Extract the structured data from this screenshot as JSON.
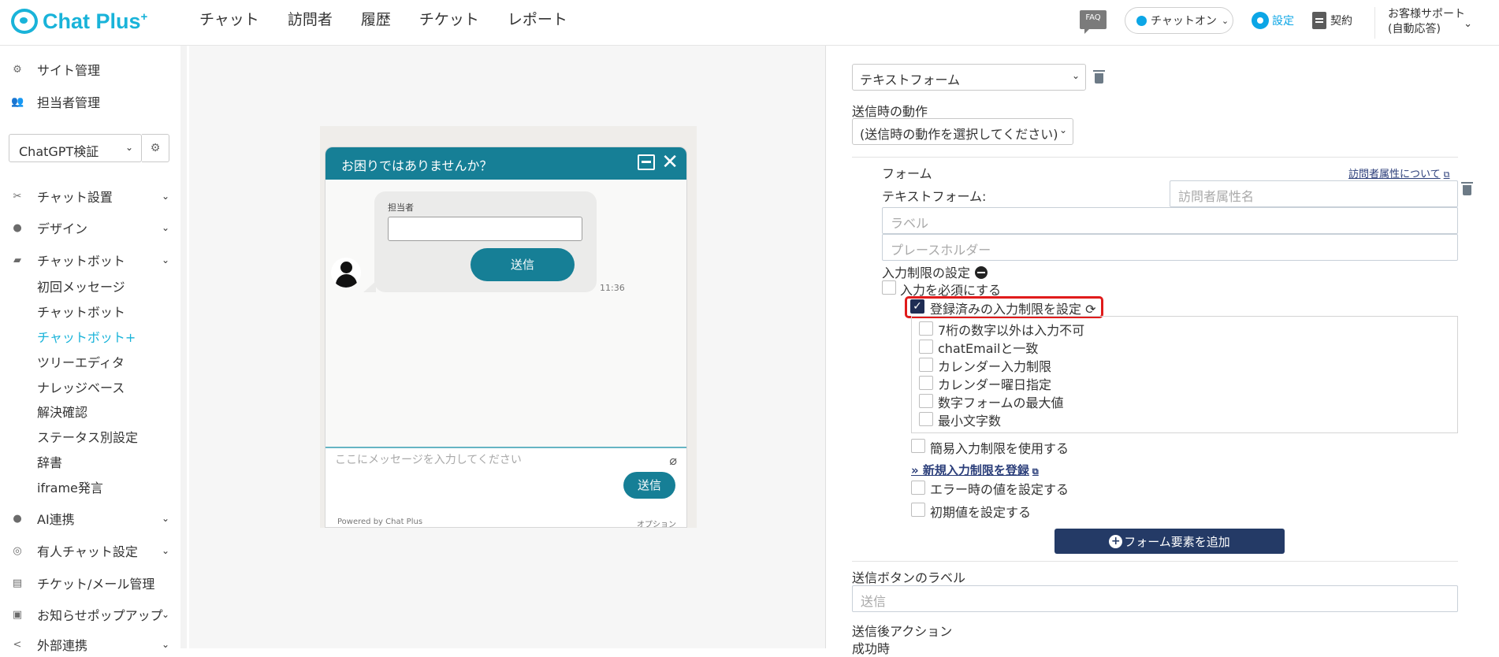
{
  "header": {
    "logo": "Chat Plus",
    "logo_sup": "+",
    "nav": [
      "チャット",
      "訪問者",
      "履歴",
      "チケット",
      "レポート"
    ],
    "faq": "FAQ",
    "status": "チャットオン",
    "settings": "設定",
    "contract": "契約",
    "support_line1": "お客様サポート",
    "support_line2": "(自動応答)"
  },
  "sidebar": {
    "site_admin": "サイト管理",
    "staff_admin": "担当者管理",
    "site_select": "ChatGPT検証",
    "chat_setup": "チャット設置",
    "design": "デザイン",
    "chatbot": "チャットボット",
    "chatbot_sub": [
      "初回メッセージ",
      "チャットボット",
      "チャットボット+",
      "ツリーエディタ",
      "ナレッジベース",
      "解決確認",
      "ステータス別設定",
      "辞書",
      "iframe発言"
    ],
    "ai": "AI連携",
    "manned": "有人チャット設定",
    "ticket_mail": "チケット/メール管理",
    "popup": "お知らせポップアップ",
    "external": "外部連携"
  },
  "preview": {
    "title": "お困りではありませんか？",
    "bubble_label": "担当者",
    "bubble_send": "送信",
    "time": "11:36",
    "input_placeholder": "ここにメッセージを入力してください",
    "send": "送信",
    "powered": "Powered by Chat Plus",
    "option": "オプション"
  },
  "form": {
    "type_select": "テキストフォーム",
    "on_send_label": "送信時の動作",
    "on_send_select": "(送信時の動作を選択してください)",
    "form_label": "フォーム",
    "visitor_attr_link": "訪問者属性について",
    "text_form_label": "テキストフォーム:",
    "visitor_attr_placeholder": "訪問者属性名",
    "label_placeholder": "ラベル",
    "placeholder_placeholder": "プレースホルダー",
    "restrict_label": "入力制限の設定",
    "required_label": "入力を必須にする",
    "registered_restrict": "登録済みの入力制限を設定",
    "restrictions": [
      "7桁の数字以外は入力不可",
      "chatEmailと一致",
      "カレンダー入力制限",
      "カレンダー曜日指定",
      "数字フォームの最大値",
      "最小文字数"
    ],
    "simple_restrict": "簡易入力制限を使用する",
    "new_restrict_link": "» 新規入力制限を登録",
    "error_value": "エラー時の値を設定する",
    "initial_value": "初期値を設定する",
    "add_element": "フォーム要素を追加",
    "send_button_label": "送信ボタンのラベル",
    "send_button_value": "送信",
    "after_send": "送信後アクション",
    "on_success": "成功時"
  }
}
